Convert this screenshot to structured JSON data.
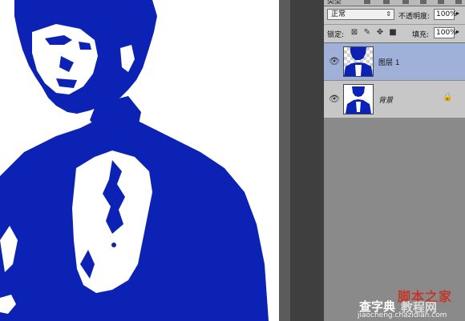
{
  "canvas": {
    "background": "#ffffff",
    "ink_color": "#0b22b4"
  },
  "panel": {
    "kind_label": "类型",
    "blend_mode": "正常",
    "opacity_label": "不透明度:",
    "opacity_value": "100%",
    "lock_label": "锁定:",
    "fill_label": "填充:",
    "fill_value": "100%",
    "lock_icons": [
      "lock-transparent-icon",
      "lock-paint-icon",
      "lock-position-icon",
      "lock-all-icon"
    ],
    "layers": [
      {
        "name": "图层 1",
        "selected": true,
        "visible": true,
        "thumb": "checker"
      },
      {
        "name": "背景",
        "selected": false,
        "visible": true,
        "locked": true,
        "thumb": "solid"
      }
    ]
  },
  "watermark": {
    "line1": "脚本之家",
    "line2a": "查字典",
    "line2b": "教程网",
    "url": "jiaocheng.chazidian.com"
  },
  "colors": {
    "selected_layer": "#9fb1d9",
    "panel_bg": "#8a8a8a",
    "canvas_ink": "#0b22b4"
  }
}
